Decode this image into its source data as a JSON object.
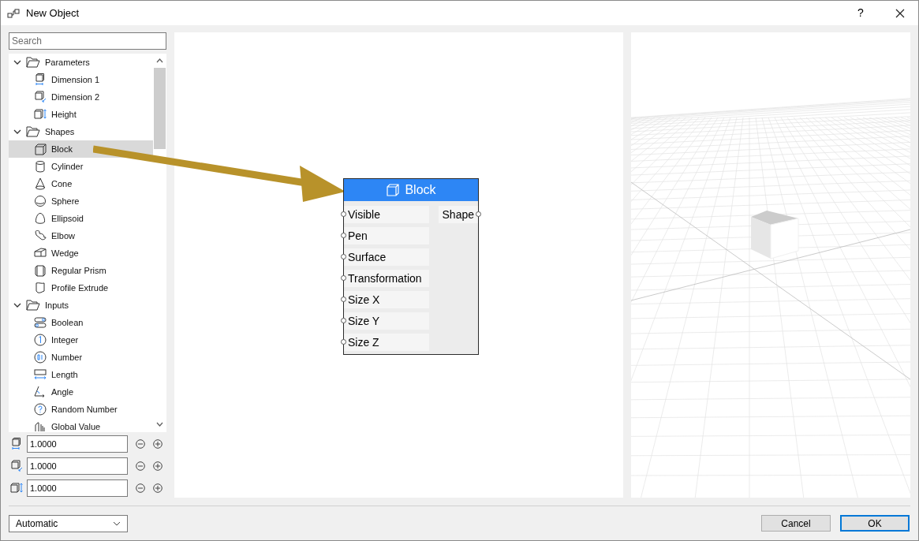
{
  "window": {
    "title": "New Object",
    "help": "?"
  },
  "search": {
    "placeholder": "Search"
  },
  "tree": [
    {
      "label": "Parameters",
      "expanded": true,
      "selected": false,
      "children": [
        {
          "label": "Dimension 1",
          "selected": false
        },
        {
          "label": "Dimension 2",
          "selected": false
        },
        {
          "label": "Height",
          "selected": false
        }
      ]
    },
    {
      "label": "Shapes",
      "expanded": true,
      "selected": false,
      "children": [
        {
          "label": "Block",
          "selected": true
        },
        {
          "label": "Cylinder",
          "selected": false
        },
        {
          "label": "Cone",
          "selected": false
        },
        {
          "label": "Sphere",
          "selected": false
        },
        {
          "label": "Ellipsoid",
          "selected": false
        },
        {
          "label": "Elbow",
          "selected": false
        },
        {
          "label": "Wedge",
          "selected": false
        },
        {
          "label": "Regular Prism",
          "selected": false
        },
        {
          "label": "Profile Extrude",
          "selected": false
        }
      ]
    },
    {
      "label": "Inputs",
      "expanded": true,
      "selected": false,
      "children": [
        {
          "label": "Boolean",
          "selected": false
        },
        {
          "label": "Integer",
          "selected": false
        },
        {
          "label": "Number",
          "selected": false
        },
        {
          "label": "Length",
          "selected": false
        },
        {
          "label": "Angle",
          "selected": false
        },
        {
          "label": "Random Number",
          "selected": false
        },
        {
          "label": "Global Value",
          "selected": false
        }
      ]
    }
  ],
  "node": {
    "title": "Block",
    "inputs": [
      "Visible",
      "Pen",
      "Surface",
      "Transformation",
      "Size X",
      "Size Y",
      "Size Z"
    ],
    "outputs": [
      "Shape"
    ]
  },
  "values": [
    {
      "value": "1.0000"
    },
    {
      "value": "1.0000"
    },
    {
      "value": "1.0000"
    }
  ],
  "mode_dropdown": {
    "value": "Automatic"
  },
  "buttons": [
    {
      "label": "Cancel",
      "default": false
    },
    {
      "label": "OK",
      "default": true
    }
  ]
}
